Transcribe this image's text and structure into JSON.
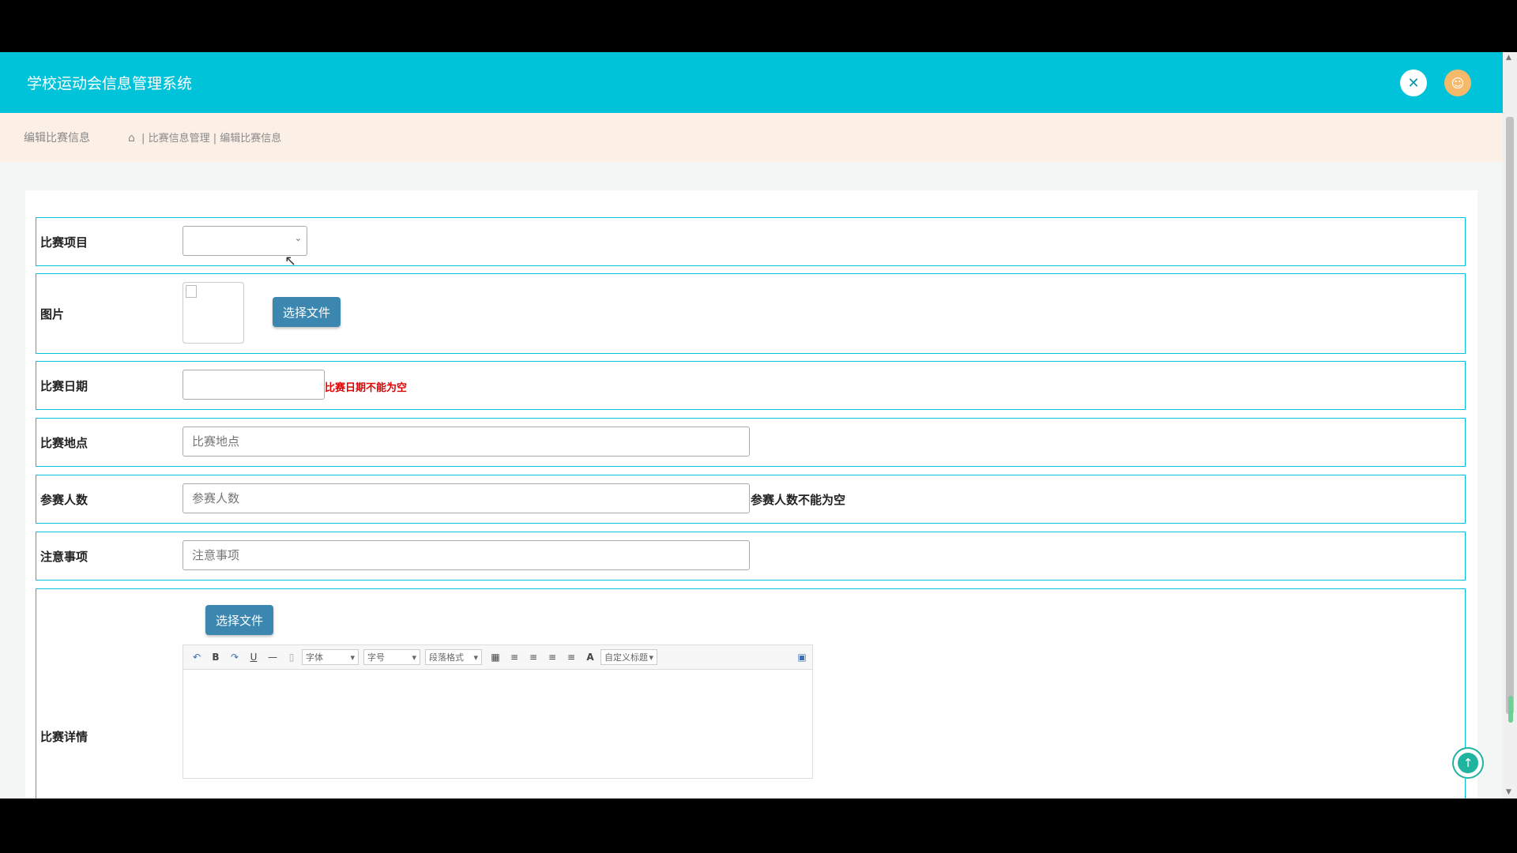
{
  "header": {
    "app_title": "学校运动会信息管理系统",
    "close_icon": "fullscreen-close-icon",
    "user_icon": "user-avatar-icon"
  },
  "crumbbar": {
    "page_title": "编辑比赛信息",
    "home_icon": "home-icon",
    "crumb_1": "比赛信息管理",
    "separator": "|",
    "crumb_2": "编辑比赛信息"
  },
  "form": {
    "project": {
      "label": "比赛项目",
      "selected": ""
    },
    "image": {
      "label": "图片",
      "upload_label": "选择文件"
    },
    "date": {
      "label": "比赛日期",
      "value": "",
      "error": "比赛日期不能为空"
    },
    "location": {
      "label": "比赛地点",
      "placeholder": "比赛地点"
    },
    "participants": {
      "label": "参赛人数",
      "placeholder": "参赛人数",
      "error": "参赛人数不能为空"
    },
    "notes": {
      "label": "注意事项",
      "placeholder": "注意事项"
    },
    "details": {
      "label": "比赛详情",
      "upload_label": "选择文件",
      "toolbar": {
        "undo": "↶",
        "bold": "B",
        "redo": "↷",
        "underline": "U",
        "hr": "—",
        "page": "▯",
        "font_family": "字体",
        "font_size": "字号",
        "paragraph": "段落格式",
        "table": "▦",
        "align_left": "≡",
        "align_center": "≡",
        "align_right": "≡",
        "justify": "≡",
        "font_color": "A",
        "custom_title": "自定义标题",
        "fullscreen": "▣"
      }
    }
  },
  "colors": {
    "accent": "#00c3da",
    "button": "#3b87b0",
    "error": "#e00000",
    "crumb_bg": "#fcefe6"
  },
  "back_to_top_icon": "arrow-up-icon"
}
